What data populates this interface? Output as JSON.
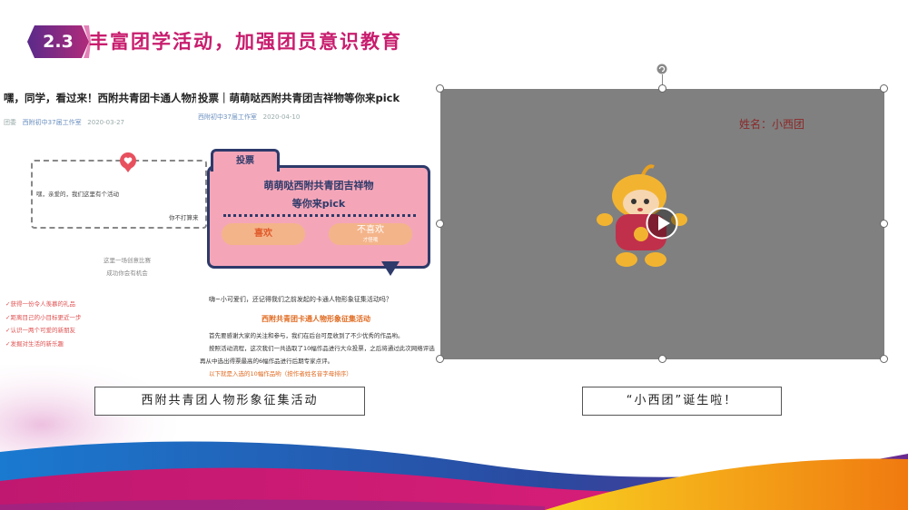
{
  "header": {
    "section_number": "2.3",
    "title": "丰富团学活动，加强团员意识教育"
  },
  "left_panel": {
    "article1": {
      "title": "嘿，同学，看过来！西附共青团卡通人物形象征集活动",
      "meta_source": "团委",
      "meta_author": "西附初中37届工作室",
      "meta_date": "2020-03-27",
      "greeting": "嘿，亲爱的，我们这里有个活动",
      "greeting_right": "你不打算来",
      "middle_lines": [
        "这里一场创意比赛",
        "成功你会有机会"
      ],
      "red_list": [
        "✓获得一份令人羡慕的礼品",
        "✓距离目己的小目标更近一步",
        "✓认识一两个可爱的新朋友",
        "✓发掘对生活的新乐趣"
      ]
    },
    "article2": {
      "title": "投票｜萌萌哒西附共青团吉祥物等你来pick",
      "meta_author": "西附初中37届工作室",
      "meta_date": "2020-04-10",
      "vote_tab": "投票",
      "vote_line1": "萌萌哒西附共青团吉祥物",
      "vote_line2": "等你来pick",
      "like_label": "喜欢",
      "dislike_label": "不喜欢",
      "dislike_sub": "才怪哦",
      "para1": "嗨~小可爱们，还记得我们之前发起的卡通人物形象征集活动吗？",
      "para_head": "西附共青团卡通人物形象征集活动",
      "para2": "首先要感谢大家的关注和参与，我们在后台可是收到了不少优秀的作品哟。",
      "para3": "按照活动流程，这次我们一共选取了10幅作品进行大众投票，之后将通过此次网络评选",
      "para4": "再从中选出得票最高的6幅作品进行后期专家点评。",
      "para5": "以下就是入选的10幅作品哟（按作者姓名音字母排序）"
    },
    "caption": "西附共青团人物形象征集活动"
  },
  "right_panel": {
    "name_label": "姓名：小西团",
    "caption": "“小西团”诞生啦！"
  },
  "colors": {
    "title": "#c81d6e",
    "hexagon": "#8e2a8a",
    "vote_card": "#f4a6b8",
    "vote_border": "#2d3a6a",
    "video_bg": "#808080"
  }
}
